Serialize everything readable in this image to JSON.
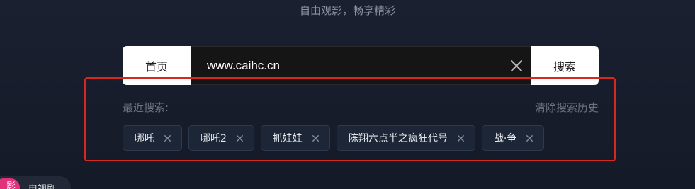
{
  "header": {
    "tagline": "自由观影，畅享精彩"
  },
  "search": {
    "home_label": "首页",
    "value": "www.caihc.cn",
    "search_label": "搜索",
    "clear_icon": "close-icon"
  },
  "history": {
    "label": "最近搜索:",
    "clear_label": "清除搜索历史",
    "tags": [
      {
        "label": "哪吒"
      },
      {
        "label": "哪吒2"
      },
      {
        "label": "抓娃娃"
      },
      {
        "label": "陈翔六点半之疯狂代号"
      },
      {
        "label": "战·争"
      }
    ],
    "highlight_color": "#d6281f"
  },
  "bottom_nav": {
    "active_label": "影",
    "next_label": "电视剧",
    "active_color": "#e0327a"
  }
}
